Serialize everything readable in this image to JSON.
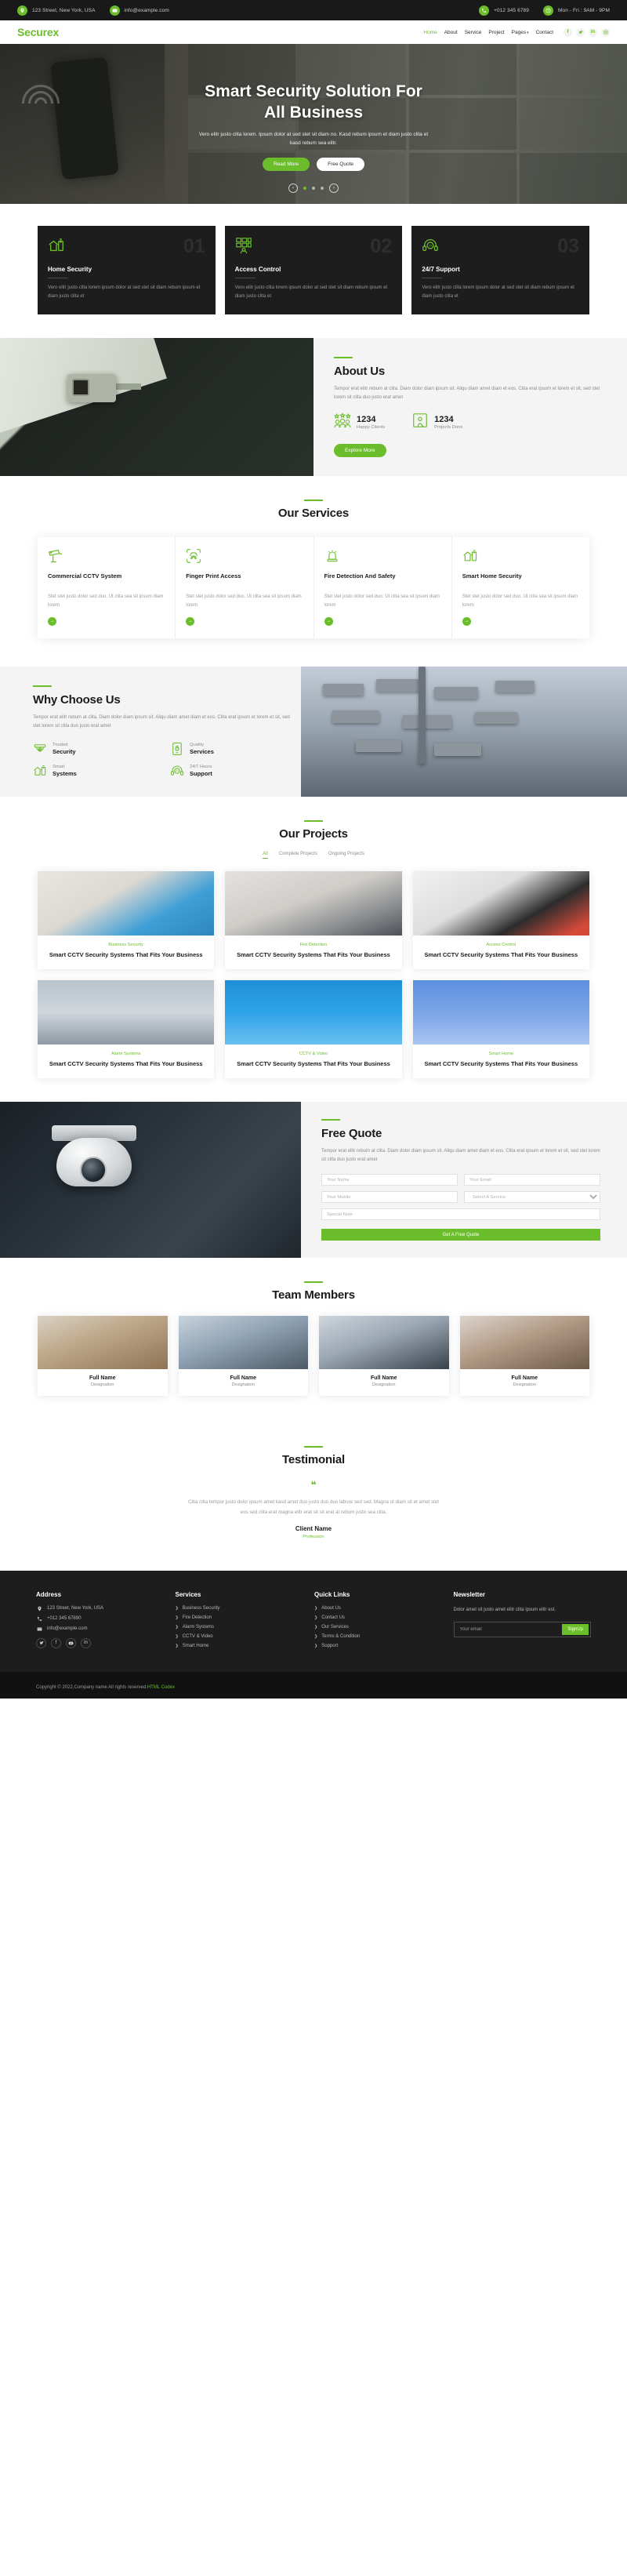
{
  "topbar": {
    "left": [
      {
        "icon": "location-pin-icon",
        "text": "123 Street, New York, USA"
      },
      {
        "icon": "envelope-icon",
        "text": "info@example.com"
      }
    ],
    "right": [
      {
        "icon": "phone-icon",
        "text": "+012 345 6789"
      },
      {
        "icon": "clock-icon",
        "text": "Mon - Fri : 9AM - 9PM"
      }
    ]
  },
  "navbar": {
    "brand": "Securex",
    "links": [
      {
        "label": "Home",
        "active": true
      },
      {
        "label": "About",
        "active": false
      },
      {
        "label": "Service",
        "active": false
      },
      {
        "label": "Project",
        "active": false
      },
      {
        "label": "Pages",
        "active": false,
        "caret": true
      },
      {
        "label": "Contact",
        "active": false
      }
    ],
    "socials": [
      "facebook-icon",
      "twitter-icon",
      "linkedin-icon",
      "instagram-icon"
    ]
  },
  "hero": {
    "title_line1": "Smart Security Solution For",
    "title_line2": "All Business",
    "subtitle": "Vero elitr justo clita lorem. Ipsum dolor at sed stet sit diam no. Kasd rebum ipsum et diam justo clita et kasd rebum sea elitr.",
    "btn_primary": "Read More",
    "btn_secondary": "Free Quote",
    "slides": 3,
    "active_slide": 1
  },
  "features": [
    {
      "icon": "smart-home-icon",
      "number": "01",
      "title": "Home Security",
      "text": "Vero elitr justo clita lorem ipsum dolor at sed stet sit diam rebum ipsum et diam justo clita et"
    },
    {
      "icon": "access-control-icon",
      "number": "02",
      "title": "Access Control",
      "text": "Vero elitr justo clita lorem ipsum dolor at sed stet sit diam rebum ipsum et diam justo clita et"
    },
    {
      "icon": "headset-support-icon",
      "number": "03",
      "title": "24/7 Support",
      "text": "Vero elitr justo clita lorem ipsum dolor at sed stet sit diam rebum ipsum et diam justo clita et"
    }
  ],
  "about": {
    "title": "About Us",
    "text": "Tempor erat elitr rebum at clita. Diam dolor diam ipsum sit. Aliqu diam amet diam et eos. Clita erat ipsum et lorem et sit, sed stet lorem sit clita duo justo erat amet",
    "stats": [
      {
        "icon": "happy-clients-icon",
        "number": "1234",
        "label": "Happy Clients"
      },
      {
        "icon": "projects-done-icon",
        "number": "1234",
        "label": "Projects Done"
      }
    ],
    "button": "Explore More"
  },
  "services": {
    "title": "Our Services",
    "cards": [
      {
        "icon": "cctv-camera-icon",
        "title": "Commercial CCTV System",
        "text": "Stet stet justo dolor sed duo. Ut clita sea sit ipsum diam lorem"
      },
      {
        "icon": "fingerprint-icon",
        "title": "Finger Print Access",
        "text": "Stet stet justo dolor sed duo. Ut clita sea sit ipsum diam lorem"
      },
      {
        "icon": "fire-alarm-icon",
        "title": "Fire Detection And Safety",
        "text": "Stet stet justo dolor sed duo. Ut clita sea sit ipsum diam lorem"
      },
      {
        "icon": "smart-home-icon",
        "title": "Smart Home Security",
        "text": "Stet stet justo dolor sed duo. Ut clita sea sit ipsum diam lorem"
      }
    ]
  },
  "why": {
    "title": "Why Choose Us",
    "text": "Tempor erat elitr rebum at clita. Diam dolor diam ipsum sit. Aliqu diam amet diam et eos. Clita erat ipsum et lorem et sit, sed stet lorem sit clita duo justo erat amet",
    "items": [
      {
        "icon": "dome-camera-icon",
        "small": "Trusted",
        "large": "Security"
      },
      {
        "icon": "mobile-lock-icon",
        "small": "Quality",
        "large": "Services"
      },
      {
        "icon": "smart-home-icon",
        "small": "Smart",
        "large": "Systems"
      },
      {
        "icon": "headset-support-icon",
        "small": "24/7 Hours",
        "large": "Support"
      }
    ]
  },
  "projects": {
    "title": "Our Projects",
    "filters": [
      {
        "label": "All",
        "active": true
      },
      {
        "label": "Complete Projects",
        "active": false
      },
      {
        "label": "Ongoing Projects",
        "active": false
      }
    ],
    "cards": [
      {
        "category": "Business Security",
        "name": "Smart CCTV Security Systems That Fits Your Business"
      },
      {
        "category": "Fire Detection",
        "name": "Smart CCTV Security Systems That Fits Your Business"
      },
      {
        "category": "Access Control",
        "name": "Smart CCTV Security Systems That Fits Your Business"
      },
      {
        "category": "Alarm Systems",
        "name": "Smart CCTV Security Systems That Fits Your Business"
      },
      {
        "category": "CCTV & Video",
        "name": "Smart CCTV Security Systems That Fits Your Business"
      },
      {
        "category": "Smart Home",
        "name": "Smart CCTV Security Systems That Fits Your Business"
      }
    ]
  },
  "quote": {
    "title": "Free Quote",
    "text": "Tempor erat elitr rebum at clita. Diam dolor diam ipsum sit. Aliqu diam amet diam et eos. Clita erat ipsum et lorem et sit, sed stet lorem sit clita duo justo erat amet",
    "name_placeholder": "Your Name",
    "email_placeholder": "Your Email",
    "mobile_placeholder": "Your Mobile",
    "service_placeholder": "Select A Service",
    "special_placeholder": "Special Note",
    "submit": "Get A Free Quote"
  },
  "team": {
    "title": "Team Members",
    "members": [
      {
        "name": "Full Name",
        "role": "Designation"
      },
      {
        "name": "Full Name",
        "role": "Designation"
      },
      {
        "name": "Full Name",
        "role": "Designation"
      },
      {
        "name": "Full Name",
        "role": "Designation"
      }
    ]
  },
  "testimonial": {
    "title": "Testimonial",
    "quote_icon": "quote-icon",
    "text": "Clita clita tempor justo dolor ipsum amet kasd amet duo justo duo duo labore sed sed. Magna ut diam sit et amet stet eos sed clita erat magna elitr erat sit sit erat at rebum justo sea clita.",
    "name": "Client Name",
    "role": "Profession"
  },
  "footer": {
    "address": {
      "head": "Address",
      "rows": [
        {
          "icon": "location-pin-icon",
          "text": "123 Street, New York, USA"
        },
        {
          "icon": "phone-icon",
          "text": "+012 345 67890"
        },
        {
          "icon": "envelope-icon",
          "text": "info@example.com"
        }
      ],
      "socials": [
        "twitter-icon",
        "facebook-icon",
        "youtube-icon",
        "linkedin-icon"
      ]
    },
    "services": {
      "head": "Services",
      "links": [
        "Business Security",
        "Fire Detection",
        "Alarm Systems",
        "CCTV & Video",
        "Smart Home"
      ]
    },
    "quick": {
      "head": "Quick Links",
      "links": [
        "About Us",
        "Contact Us",
        "Our Services",
        "Terms & Condition",
        "Support"
      ]
    },
    "newsletter": {
      "head": "Newsletter",
      "text": "Dolor amet sit justo amet elitr clita ipsum elitr est.",
      "placeholder": "Your email",
      "button": "SignUp"
    },
    "copyright_main": "Copyright © 2022,Company name All rights reserved.",
    "copyright_link": "HTML Codex"
  },
  "colors": {
    "accent": "#6cbd2c",
    "dark": "#1d1d1d",
    "topbar": "#191919",
    "light_bg": "#f4f4f4"
  }
}
